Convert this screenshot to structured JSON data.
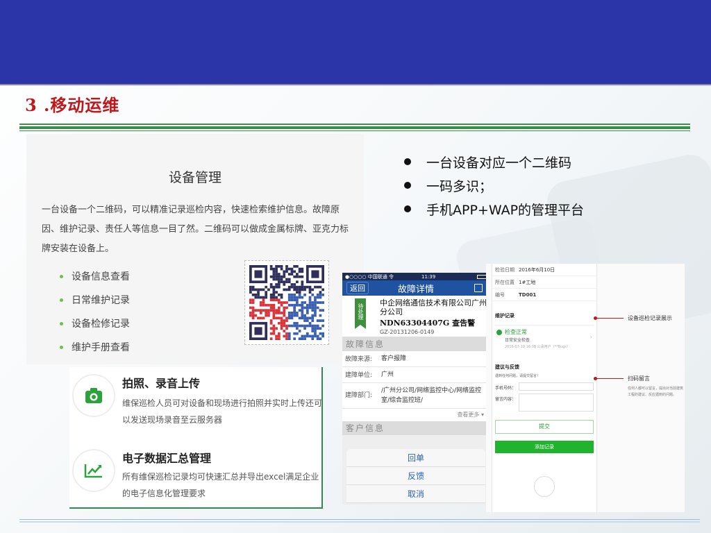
{
  "slide": {
    "title": "3 .移动运维"
  },
  "device_panel": {
    "title": "设备管理",
    "description": "一台设备一个二维码，可以精准记录巡检内容，快速检索维护信息。故障原因、维护记录、责任人等信息一目了然。二维码可以做成金属标牌、亚克力标牌安装在设备上。",
    "items": [
      "设备信息查看",
      "日常维护记录",
      "设备检修记录",
      "维护手册查看"
    ]
  },
  "bullets": [
    "一台设备对应一个二维码",
    "一码多识；",
    "手机APP+WAP的管理平台"
  ],
  "features": [
    {
      "icon": "camera-icon",
      "title": "拍照、录音上传",
      "desc": "维保巡检人员可对设备和现场进行拍照并实时上传还可以发送现场录音至云服务器"
    },
    {
      "icon": "trend-chart-icon",
      "title": "电子数据汇总管理",
      "desc": "所有维保巡检记录均可快速汇总并导出excel满足企业的电子信息化管理要求"
    }
  ],
  "phone1": {
    "status_carrier": "●○○○○ 中国联通 令",
    "status_time": "11:39",
    "back_label": "返回",
    "nav_title": "故障详情",
    "ribbon": "待处理",
    "company_name": "中企网络通信技术有限公司广州分公司",
    "device_code": "NDN63304407G 查告警",
    "ticket_id": "GZ-20131206-0149",
    "section_fault": "故障信息",
    "rows": [
      {
        "k": "故障来源:",
        "v": "客户报障"
      },
      {
        "k": "建障单位:",
        "v": "广州"
      },
      {
        "k": "建障部门:",
        "v": "/广州分公司/网络监控中心/网络监控室/综合监控班/"
      }
    ],
    "more": "查看更多 ▾",
    "section_customer": "客户信息",
    "sheet": [
      "回单",
      "反馈",
      "取消"
    ]
  },
  "phone2": {
    "kv": [
      {
        "k": "检验日期",
        "v": "2016年6月10日"
      },
      {
        "k": "所在位置",
        "v": "1#工地"
      },
      {
        "k": "编号",
        "v": "TD001"
      }
    ],
    "maint_section": "维护记录",
    "check_title": "检查正常",
    "check_desc": "日常安全检查",
    "check_time": "2016-07-10 16:08  公承用户（**Bugs）",
    "advice_section": "建议与反馈",
    "advice_hint": "遇到任何问题，请提交留言！",
    "phone_label": "手机号码：",
    "content_label": "留言内容：",
    "submit": "提交",
    "add_record": "添加记录",
    "callout1": "设备巡检记录展示",
    "callout2": "扫码留言",
    "callout2_desc": "任何人都可以留言，提出对当前建筑工程的建议、反应遇到的问题。"
  },
  "colors": {
    "header_blue": "#2b35a8",
    "title_red": "#c0171b",
    "rule_green": "#3c8c4a",
    "accent_green": "#2aa33a"
  }
}
